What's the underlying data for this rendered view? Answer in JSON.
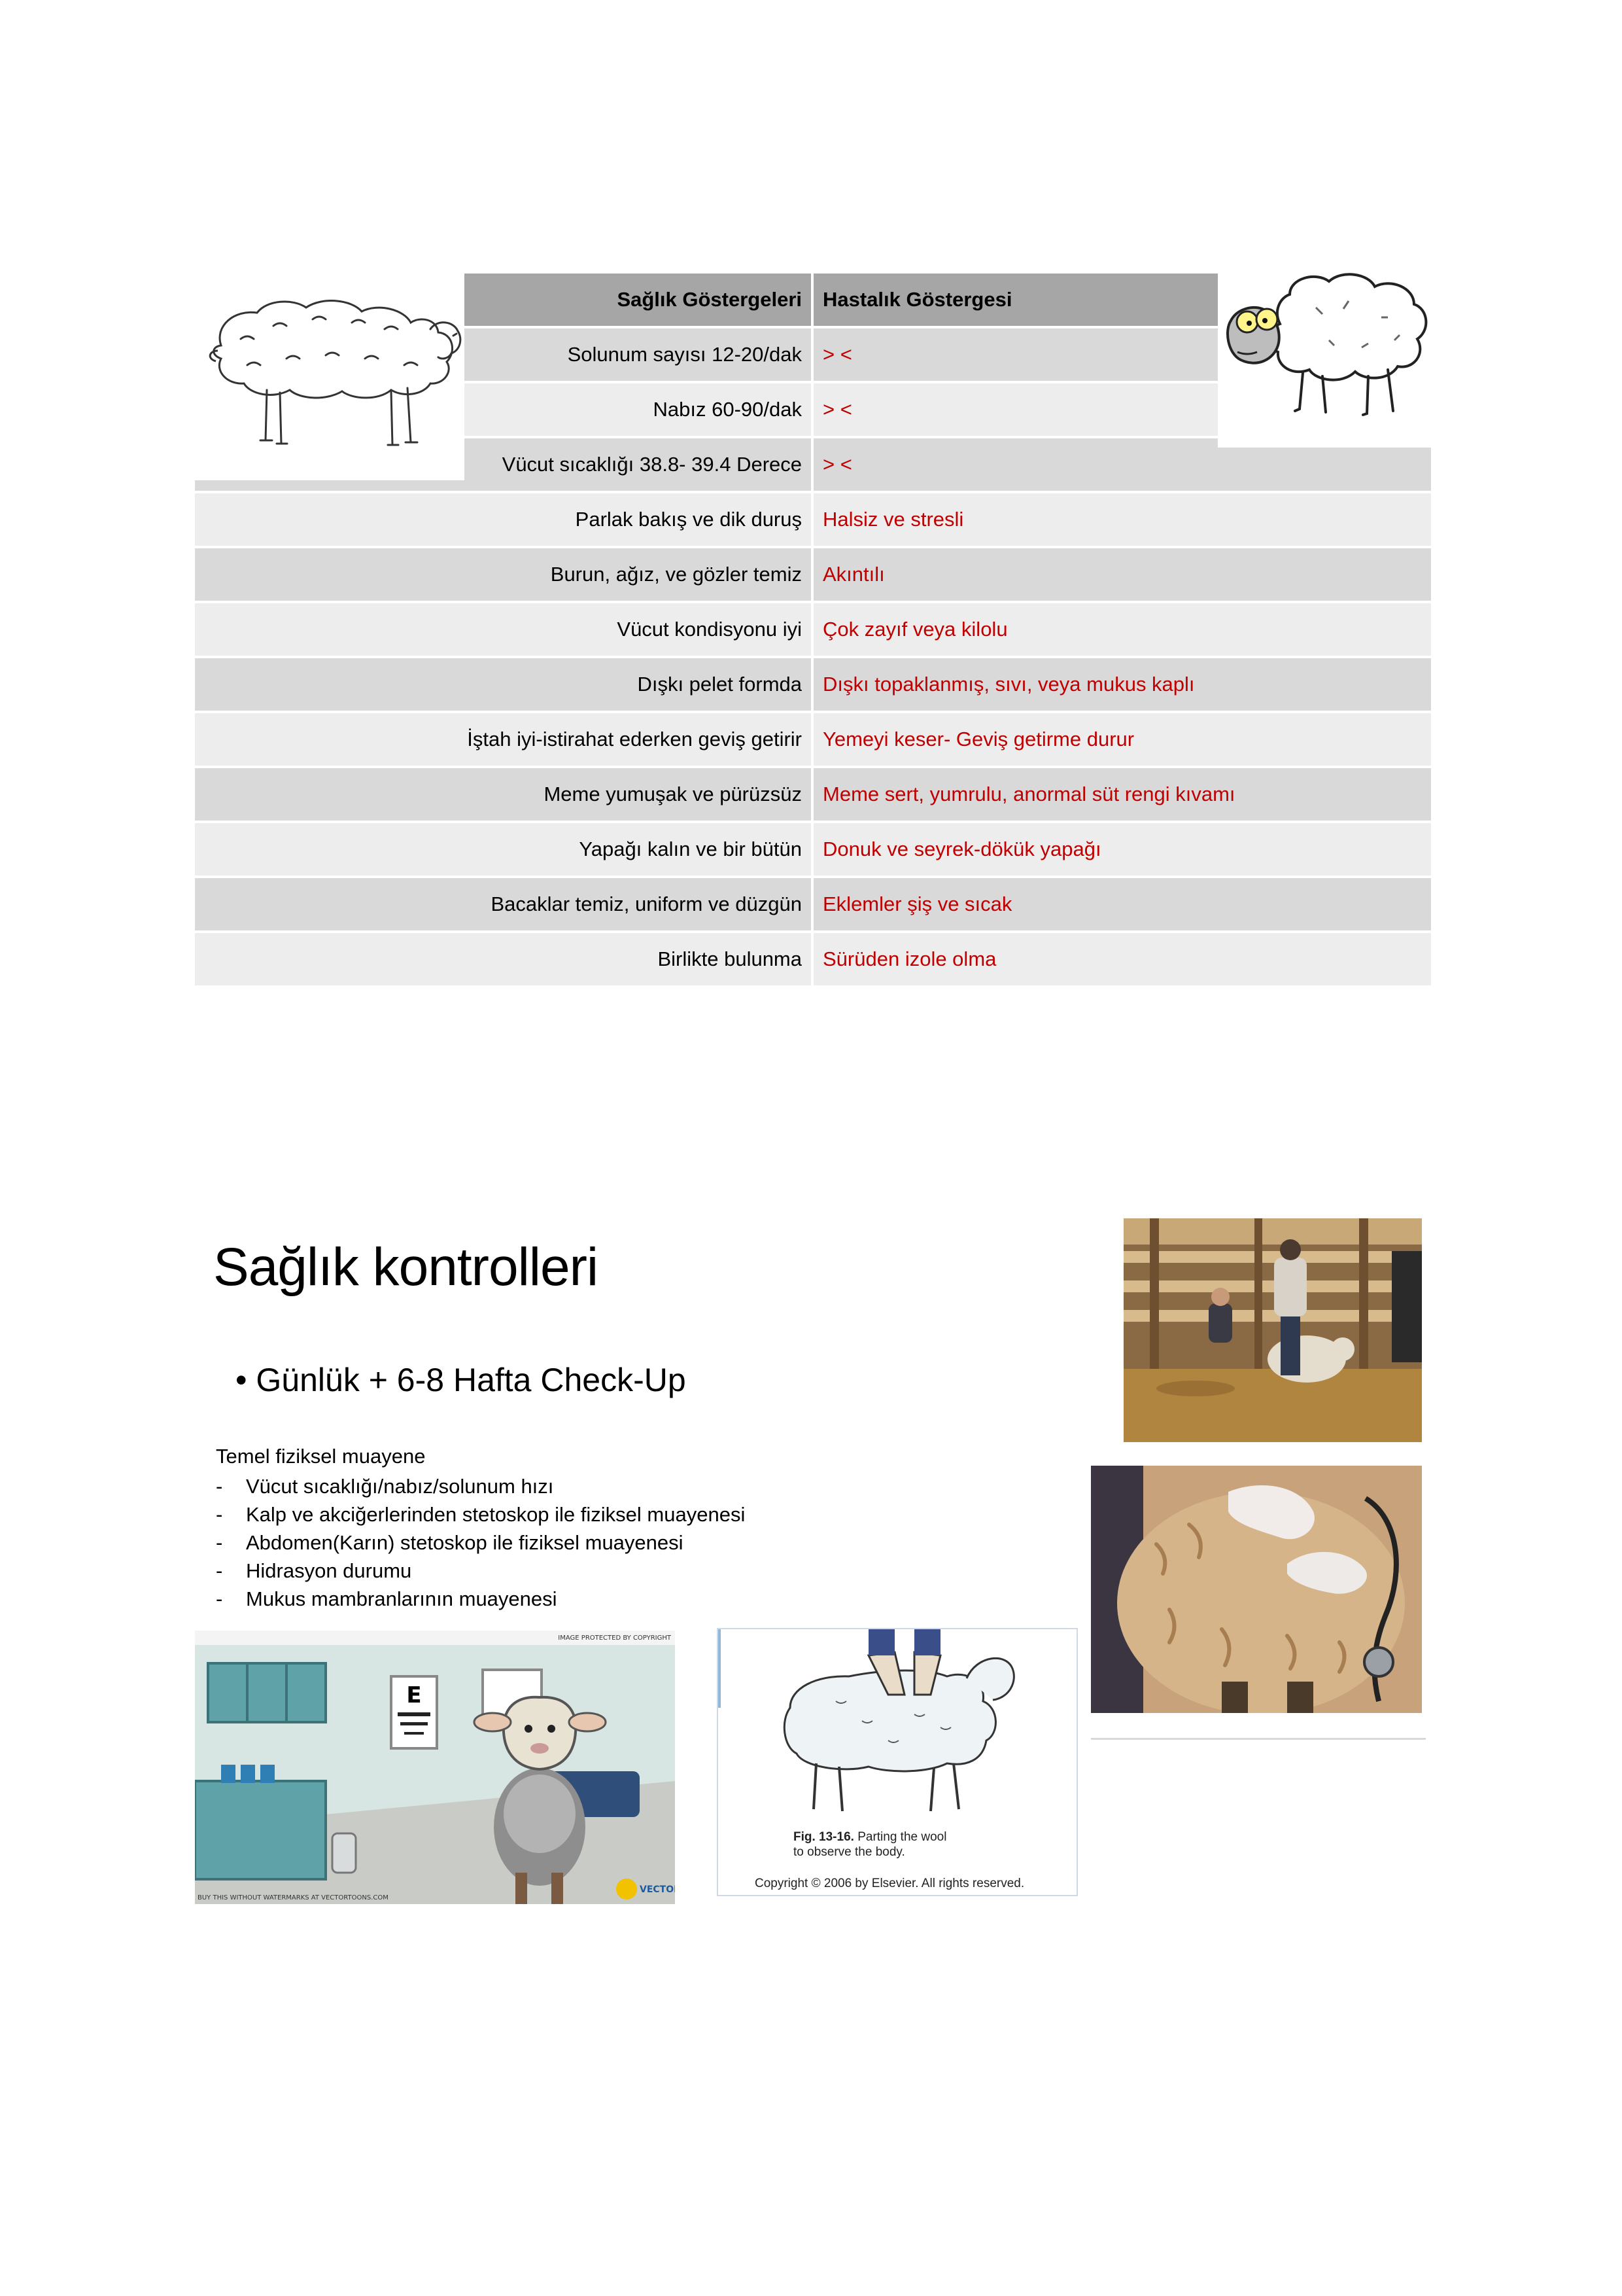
{
  "table": {
    "header": {
      "left": "Sağlık Göstergeleri",
      "right": "Hastalık Göstergesi"
    },
    "rows": [
      {
        "left": "Solunum sayısı 12-20/dak",
        "right": ">  <"
      },
      {
        "left": "Nabız 60-90/dak",
        "right": ">  <"
      },
      {
        "left": "Vücut sıcaklığı 38.8- 39.4 Derece",
        "right": ">  <"
      },
      {
        "left": "Parlak bakış ve dik duruş",
        "right": "Halsiz ve stresli"
      },
      {
        "left": "Burun, ağız, ve gözler temiz",
        "right": "Akıntılı"
      },
      {
        "left": "Vücut kondisyonu iyi",
        "right": "Çok zayıf veya kilolu"
      },
      {
        "left": "Dışkı pelet formda",
        "right": "Dışkı topaklanmış, sıvı, veya mukus kaplı"
      },
      {
        "left": "İştah iyi-istirahat ederken geviş getirir",
        "right": "Yemeyi keser- Geviş getirme durur"
      },
      {
        "left": "Meme yumuşak ve pürüzsüz",
        "right": "Meme sert, yumrulu, anormal süt rengi kıvamı"
      },
      {
        "left": "Yapağı kalın ve bir bütün",
        "right": "Donuk ve seyrek-dökük yapağı"
      },
      {
        "left": "Bacaklar temiz, uniform ve düzgün",
        "right": "Eklemler şiş ve sıcak"
      },
      {
        "left": "Birlikte bulunma",
        "right": "Sürüden izole olma"
      }
    ]
  },
  "section": {
    "title": "Sağlık kontrolleri",
    "bullet": "• Günlük + 6-8 Hafta Check-Up",
    "exam_heading": "Temel fiziksel muayene",
    "exam_items": [
      "Vücut sıcaklığı/nabız/solunum hızı",
      "Kalp ve akciğerlerinden stetoskop ile fiziksel muayenesi",
      "Abdomen(Karın) stetoskop ile fiziksel muayenesi",
      "Hidrasyon durumu",
      "Mukus mambranlarının muayenesi"
    ]
  },
  "figure": {
    "caption_bold": "Fig. 13-16.",
    "caption_text": " Parting the wool to observe the body.",
    "copyright": "Copyright © 2006 by Elsevier. All rights reserved."
  },
  "cartoon": {
    "watermark_top": "IMAGE PROTECTED BY COPYRIGHT",
    "watermark_bottom": "BUY THIS WITHOUT WATERMARKS AT VECTORTOONS.COM",
    "logo": "VECTOR TOONS",
    "eye_chart": "E"
  },
  "colors": {
    "indicator_red": "#c00000",
    "header_gray": "#a6a6a6",
    "row_dark": "#d9d9d9",
    "row_light": "#ededed"
  }
}
